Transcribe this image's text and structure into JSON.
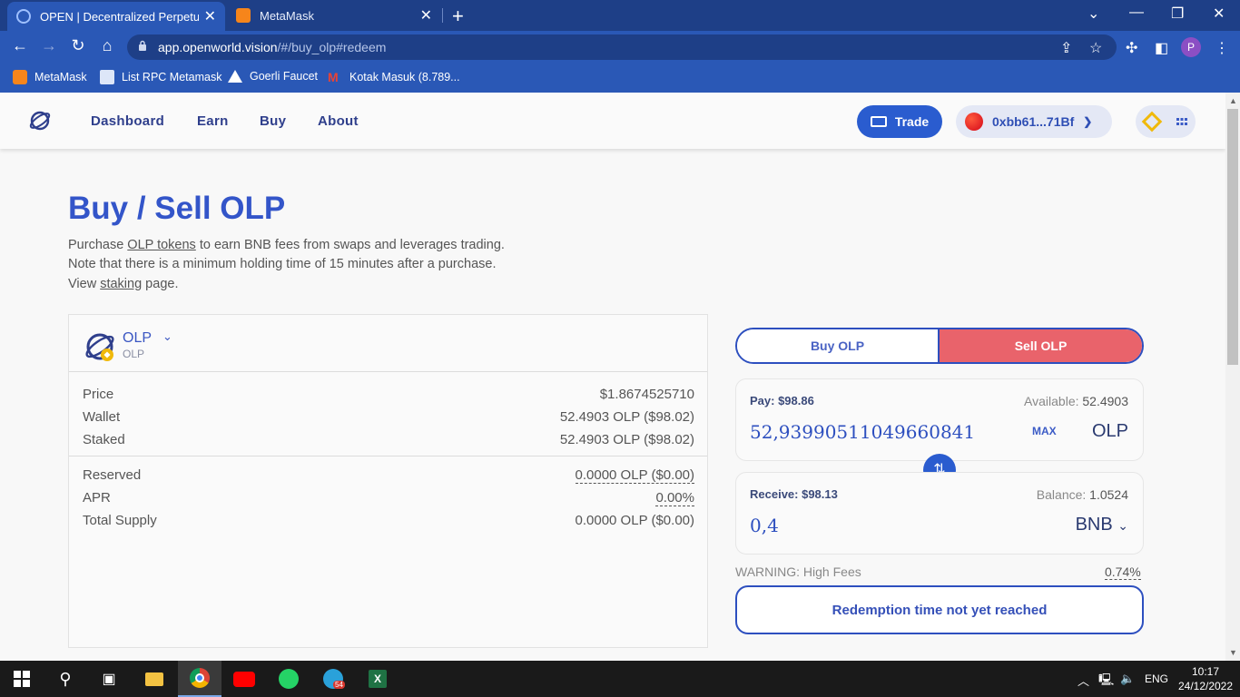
{
  "browser": {
    "tabs": [
      {
        "title": "OPEN | Decentralized Perpetual E",
        "active": true
      },
      {
        "title": "MetaMask",
        "active": false
      }
    ],
    "url_host": "app.openworld.vision",
    "url_path": "/#/buy_olp#redeem",
    "profile_initial": "P",
    "bookmarks": [
      {
        "label": "MetaMask"
      },
      {
        "label": "List RPC Metamask"
      },
      {
        "label": "Goerli Faucet"
      },
      {
        "label": "Kotak Masuk (8.789..."
      }
    ]
  },
  "nav": {
    "links": [
      "Dashboard",
      "Earn",
      "Buy",
      "About"
    ],
    "trade_label": "Trade",
    "wallet_address": "0xbb61...71Bf"
  },
  "main": {
    "title": "Buy / Sell OLP",
    "desc_line1_pre": "Purchase ",
    "desc_line1_link": "OLP tokens",
    "desc_line1_post": " to earn BNB fees from swaps and leverages trading.",
    "desc_line2": "Note that there is a minimum holding time of 15 minutes after a purchase.",
    "desc_line3_pre": "View ",
    "desc_line3_link": "staking",
    "desc_line3_post": " page."
  },
  "token_panel": {
    "name": "OLP",
    "symbol": "OLP",
    "rows": [
      {
        "label": "Price",
        "value": "$1.8674525710"
      },
      {
        "label": "Wallet",
        "value": "52.4903 OLP ($98.02)"
      },
      {
        "label": "Staked",
        "value": "52.4903 OLP ($98.02)"
      },
      {
        "label": "Reserved",
        "value": "0.0000 OLP ($0.00)"
      },
      {
        "label": "APR",
        "value": "0.00%"
      },
      {
        "label": "Total Supply",
        "value": "0.0000 OLP ($0.00)"
      }
    ]
  },
  "swap": {
    "buy_tab": "Buy OLP",
    "sell_tab": "Sell OLP",
    "pay_label": "Pay: $98.86",
    "available_label": "Available:",
    "available_value": "52.4903",
    "pay_amount": "52,93990511049660841",
    "max_label": "MAX",
    "pay_token": "OLP",
    "receive_label": "Receive: $98.13",
    "balance_label": "Balance:",
    "balance_value": "1.0524",
    "receive_amount": "0,4",
    "receive_token": "BNB",
    "warning_label": "WARNING: High Fees",
    "warning_value": "0.74%",
    "action_label": "Redemption time not yet reached"
  },
  "taskbar": {
    "telegram_badge": "54",
    "lang": "ENG",
    "time": "10:17",
    "date": "24/12/2022"
  }
}
